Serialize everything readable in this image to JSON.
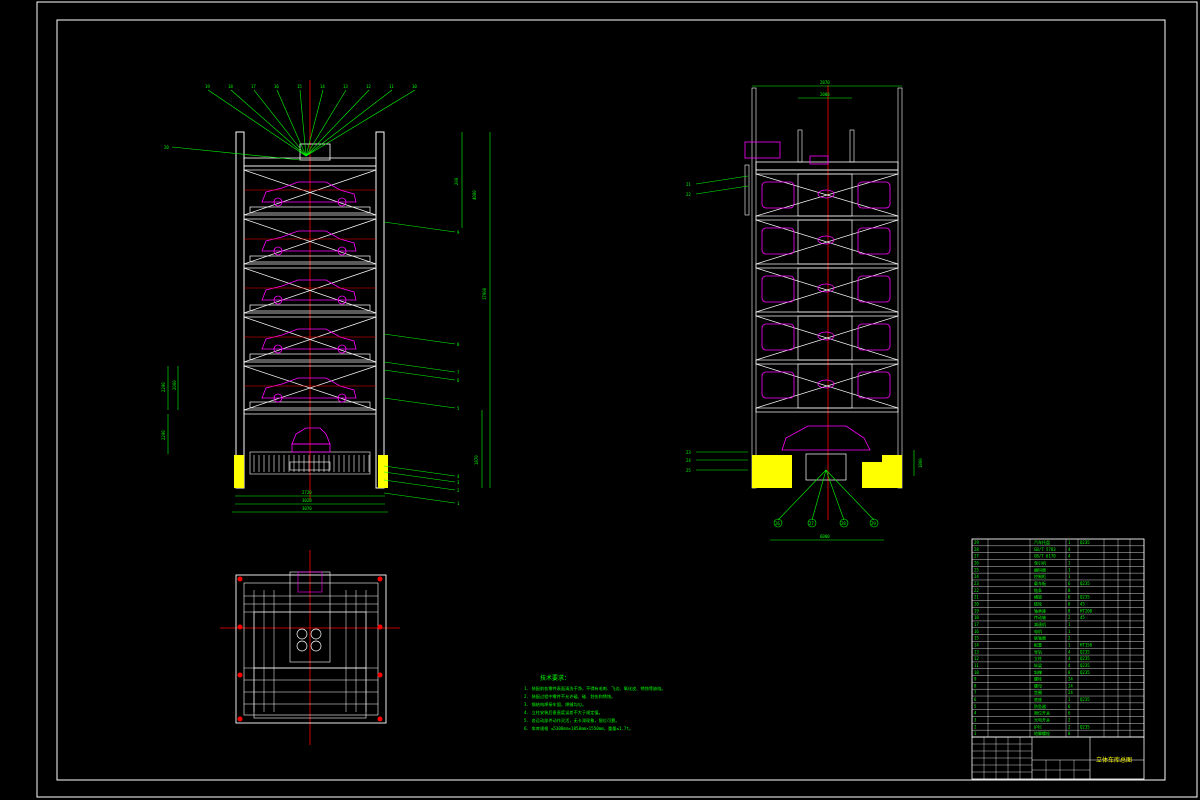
{
  "drawing": {
    "title_block_name": "立体车库总图",
    "notes_heading": "技术要求：",
    "notes": [
      "1. 装配前各零件表面清洗干净，不得有毛刺、飞边、氧化皮、锈蚀等缺陷。",
      "2. 装配过程中零件不允许磕、碰、划伤和锈蚀。",
      "3. 钢结构焊接牢固，焊缝均匀。",
      "4. 立柱安装后垂直度误差不大于规定值。",
      "5. 各运动部件动作灵活，无卡滞现象，限位可靠。",
      "6. 车库规格 ≤5300mm×1850mm×1550mm，重量≤1.7t。"
    ],
    "front_balloons_top": [
      "19",
      "18",
      "17",
      "16",
      "15",
      "14",
      "13",
      "12",
      "11",
      "10"
    ],
    "front_balloons_right": [
      "9",
      "8",
      "7",
      "6",
      "5",
      "4",
      "3",
      "2",
      "1"
    ],
    "front_balloon_left": "20",
    "side_balloons_left": [
      "21",
      "22",
      "23",
      "24",
      "25"
    ],
    "side_balloons_bottom": [
      "26",
      "27",
      "28",
      "29"
    ],
    "front_dims": {
      "bottom1": "2720",
      "bottom2": "3020",
      "bottom3": "3070",
      "right_total": "17000",
      "right_top": "4000",
      "right_mid": "200",
      "right_bottom": "1870",
      "left1": "2290",
      "left2": "2000",
      "left3": "2290"
    },
    "side_dims": {
      "top1": "2870",
      "top2": "2000",
      "bottom": "6000",
      "right": "1800"
    },
    "bom_rows": [
      [
        "29",
        "汽车托盘",
        "1",
        "Q235"
      ],
      [
        "28",
        "GB/T 5783",
        "4",
        ""
      ],
      [
        "27",
        "GB/T 6170",
        "4",
        ""
      ],
      [
        "26",
        "曳引机",
        "1",
        ""
      ],
      [
        "25",
        "编码器",
        "1",
        ""
      ],
      [
        "24",
        "控制柜",
        "1",
        ""
      ],
      [
        "23",
        "载车板",
        "6",
        "Q235"
      ],
      [
        "22",
        "链条",
        "8",
        ""
      ],
      [
        "21",
        "横梁",
        "6",
        "Q235"
      ],
      [
        "20",
        "链轮",
        "8",
        "45"
      ],
      [
        "19",
        "轴承座",
        "8",
        "HT200"
      ],
      [
        "18",
        "传动轴",
        "2",
        "45"
      ],
      [
        "17",
        "减速机",
        "1",
        ""
      ],
      [
        "16",
        "电机",
        "1",
        ""
      ],
      [
        "15",
        "联轴器",
        "2",
        ""
      ],
      [
        "14",
        "配重",
        "1",
        "HT150"
      ],
      [
        "13",
        "导轨",
        "4",
        "Q235"
      ],
      [
        "12",
        "立柱",
        "4",
        "Q235"
      ],
      [
        "11",
        "纵梁",
        "4",
        "Q235"
      ],
      [
        "10",
        "斜撑",
        "8",
        "Q235"
      ],
      [
        "9",
        "螺栓",
        "24",
        ""
      ],
      [
        "8",
        "螺母",
        "24",
        ""
      ],
      [
        "7",
        "垫圈",
        "24",
        ""
      ],
      [
        "6",
        "底座",
        "1",
        "Q235"
      ],
      [
        "5",
        "防坠器",
        "6",
        ""
      ],
      [
        "4",
        "限位开关",
        "6",
        ""
      ],
      [
        "3",
        "光电开关",
        "2",
        ""
      ],
      [
        "2",
        "护栏",
        "2",
        "Q235"
      ],
      [
        "1",
        "地脚螺栓",
        "8",
        ""
      ]
    ],
    "colors": {
      "frame": "#ffffff",
      "dim": "#00ff00",
      "car": "#ff00ff",
      "center": "#ff0000",
      "accent": "#ffff00"
    }
  }
}
